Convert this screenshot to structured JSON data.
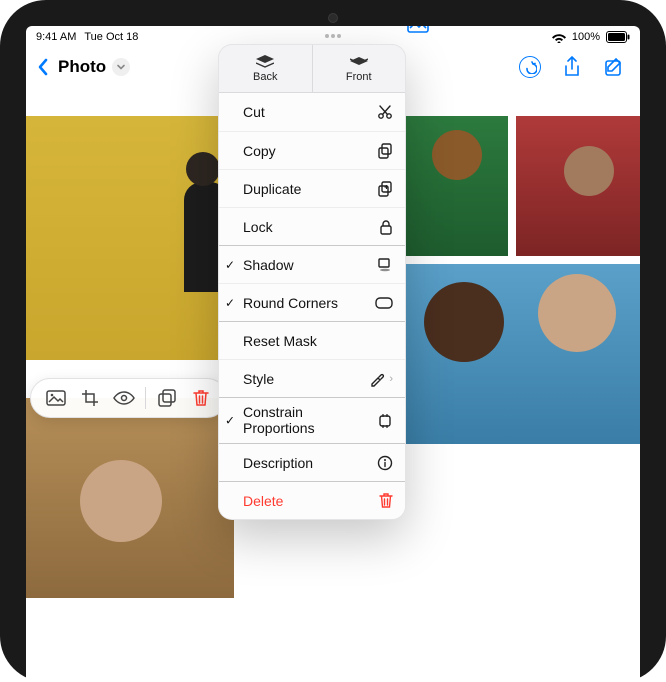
{
  "status": {
    "time": "9:41 AM",
    "date": "Tue Oct 18",
    "wifi": true,
    "battery_percent": "100%"
  },
  "nav": {
    "section_title": "Photo"
  },
  "selection_toolbar": {
    "icons": [
      "image-icon",
      "crop-icon",
      "eye-icon",
      "duplicate-icon",
      "trash-icon"
    ]
  },
  "popover": {
    "segments": {
      "back": "Back",
      "front": "Front"
    },
    "items": [
      {
        "label": "Cut",
        "icon": "scissors-icon",
        "checked": false,
        "sep": "first"
      },
      {
        "label": "Copy",
        "icon": "copy-icon",
        "checked": false
      },
      {
        "label": "Duplicate",
        "icon": "duplicate-icon",
        "checked": false
      },
      {
        "label": "Lock",
        "icon": "lock-icon",
        "checked": false
      },
      {
        "label": "Shadow",
        "icon": "shadow-icon",
        "checked": true,
        "sep": "group"
      },
      {
        "label": "Round Corners",
        "icon": "roundrect-icon",
        "checked": true
      },
      {
        "label": "Reset Mask",
        "icon": "",
        "checked": false,
        "sep": "group"
      },
      {
        "label": "Style",
        "icon": "eyedropper-icon",
        "checked": false,
        "disclosure": true
      },
      {
        "label": "Constrain Proportions",
        "icon": "constrain-icon",
        "checked": true,
        "twoline": true,
        "sep": "group"
      },
      {
        "label": "Description",
        "icon": "info-icon",
        "checked": false,
        "sep": "group"
      },
      {
        "label": "Delete",
        "icon": "trash-icon",
        "checked": false,
        "delete": true,
        "sep": "group"
      }
    ]
  }
}
